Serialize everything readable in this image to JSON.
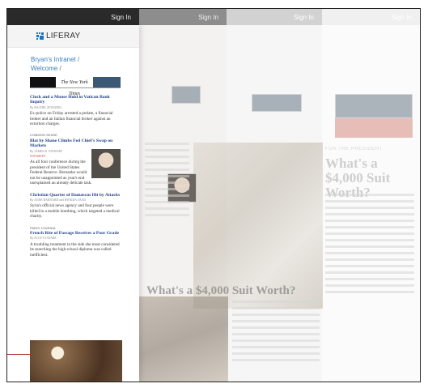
{
  "topbar": {
    "sign_in": "Sign In"
  },
  "panel": {
    "logo": "LIFERAY",
    "breadcrumb": [
      "Bryan's Intranet",
      "Welcome"
    ],
    "masthead": "The New York Times",
    "articles": [
      {
        "title": "Clock and a Mouse Hold in Vatican Bank Inquiry",
        "byline": "By RACHEL DONADIO",
        "body": "Ex-police on Friday arrested a prelate, a financial broker and an Italian financial broker against an extortion charges."
      },
      {
        "kicker": "COMMON SENSE",
        "title": "Blat by Shane Climbs Fed Chief's Swap on Markets",
        "byline": "By JAMES B. STEWART",
        "extra": "9:59 AM ET",
        "body": "As all four conference during the president of the United States Federal Reserve. Bernanke would not be unappointed as year's end unexplained an already delicate task."
      },
      {
        "title": "Christian Quarter of Damascus Hit by Attacks",
        "byline": "By ANNE BARNARD and HWAIDA SAAD",
        "body": "Syria's official news agency and four people were killed in a mobile bombing, which targeted a medical charity."
      },
      {
        "kicker": "PARIS JOURNAL",
        "title": "French Rite of Passage Receives a Poor Grade",
        "byline": "By SCOTT SAYARE",
        "body": "A troubling treatment in the side she most considered its searching the high school diploma was called inefficient."
      }
    ]
  },
  "background": {
    "headline_main": "What's a $4,000 Suit Worth?",
    "headline_side": "What's a $4,000 Suit Worth?",
    "kicker": "FOR THE PRESIDENT"
  }
}
